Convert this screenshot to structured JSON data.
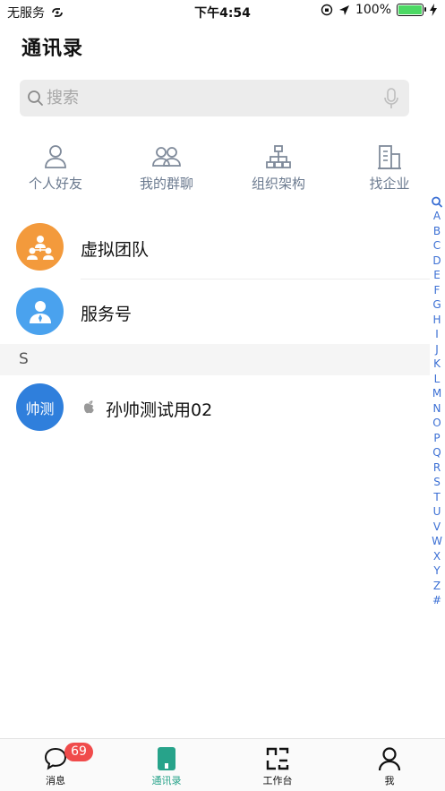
{
  "status_bar": {
    "carrier": "无服务",
    "time": "下午4:54",
    "battery": "100%",
    "battery_level": 1.0
  },
  "page": {
    "title": "通讯录"
  },
  "search": {
    "placeholder": "搜索"
  },
  "quick_entries": [
    {
      "label": "个人好友",
      "icon": "person-friends-icon"
    },
    {
      "label": "我的群聊",
      "icon": "group-chat-icon"
    },
    {
      "label": "组织架构",
      "icon": "org-chart-icon"
    },
    {
      "label": "找企业",
      "icon": "building-icon"
    }
  ],
  "list": {
    "virtual_team": {
      "label": "虚拟团队",
      "color": "#f39a3c"
    },
    "service_account": {
      "label": "服务号",
      "color": "#4aa2ee"
    }
  },
  "section": {
    "letter": "S"
  },
  "contacts": [
    {
      "avatar_text": "帅测",
      "name": "孙帅测试用02",
      "platform_icon": "apple-icon",
      "color": "#2f7fdc"
    }
  ],
  "alphabet": [
    "A",
    "B",
    "C",
    "D",
    "E",
    "F",
    "G",
    "H",
    "I",
    "J",
    "K",
    "L",
    "M",
    "N",
    "O",
    "P",
    "Q",
    "R",
    "S",
    "T",
    "U",
    "V",
    "W",
    "X",
    "Y",
    "Z",
    "#"
  ],
  "tab_bar": {
    "messages": {
      "label": "消息",
      "badge": "69"
    },
    "contacts": {
      "label": "通讯录"
    },
    "workbench": {
      "label": "工作台"
    },
    "me": {
      "label": "我"
    },
    "active_color": "#27a38a",
    "badge_color": "#f04b4b"
  }
}
